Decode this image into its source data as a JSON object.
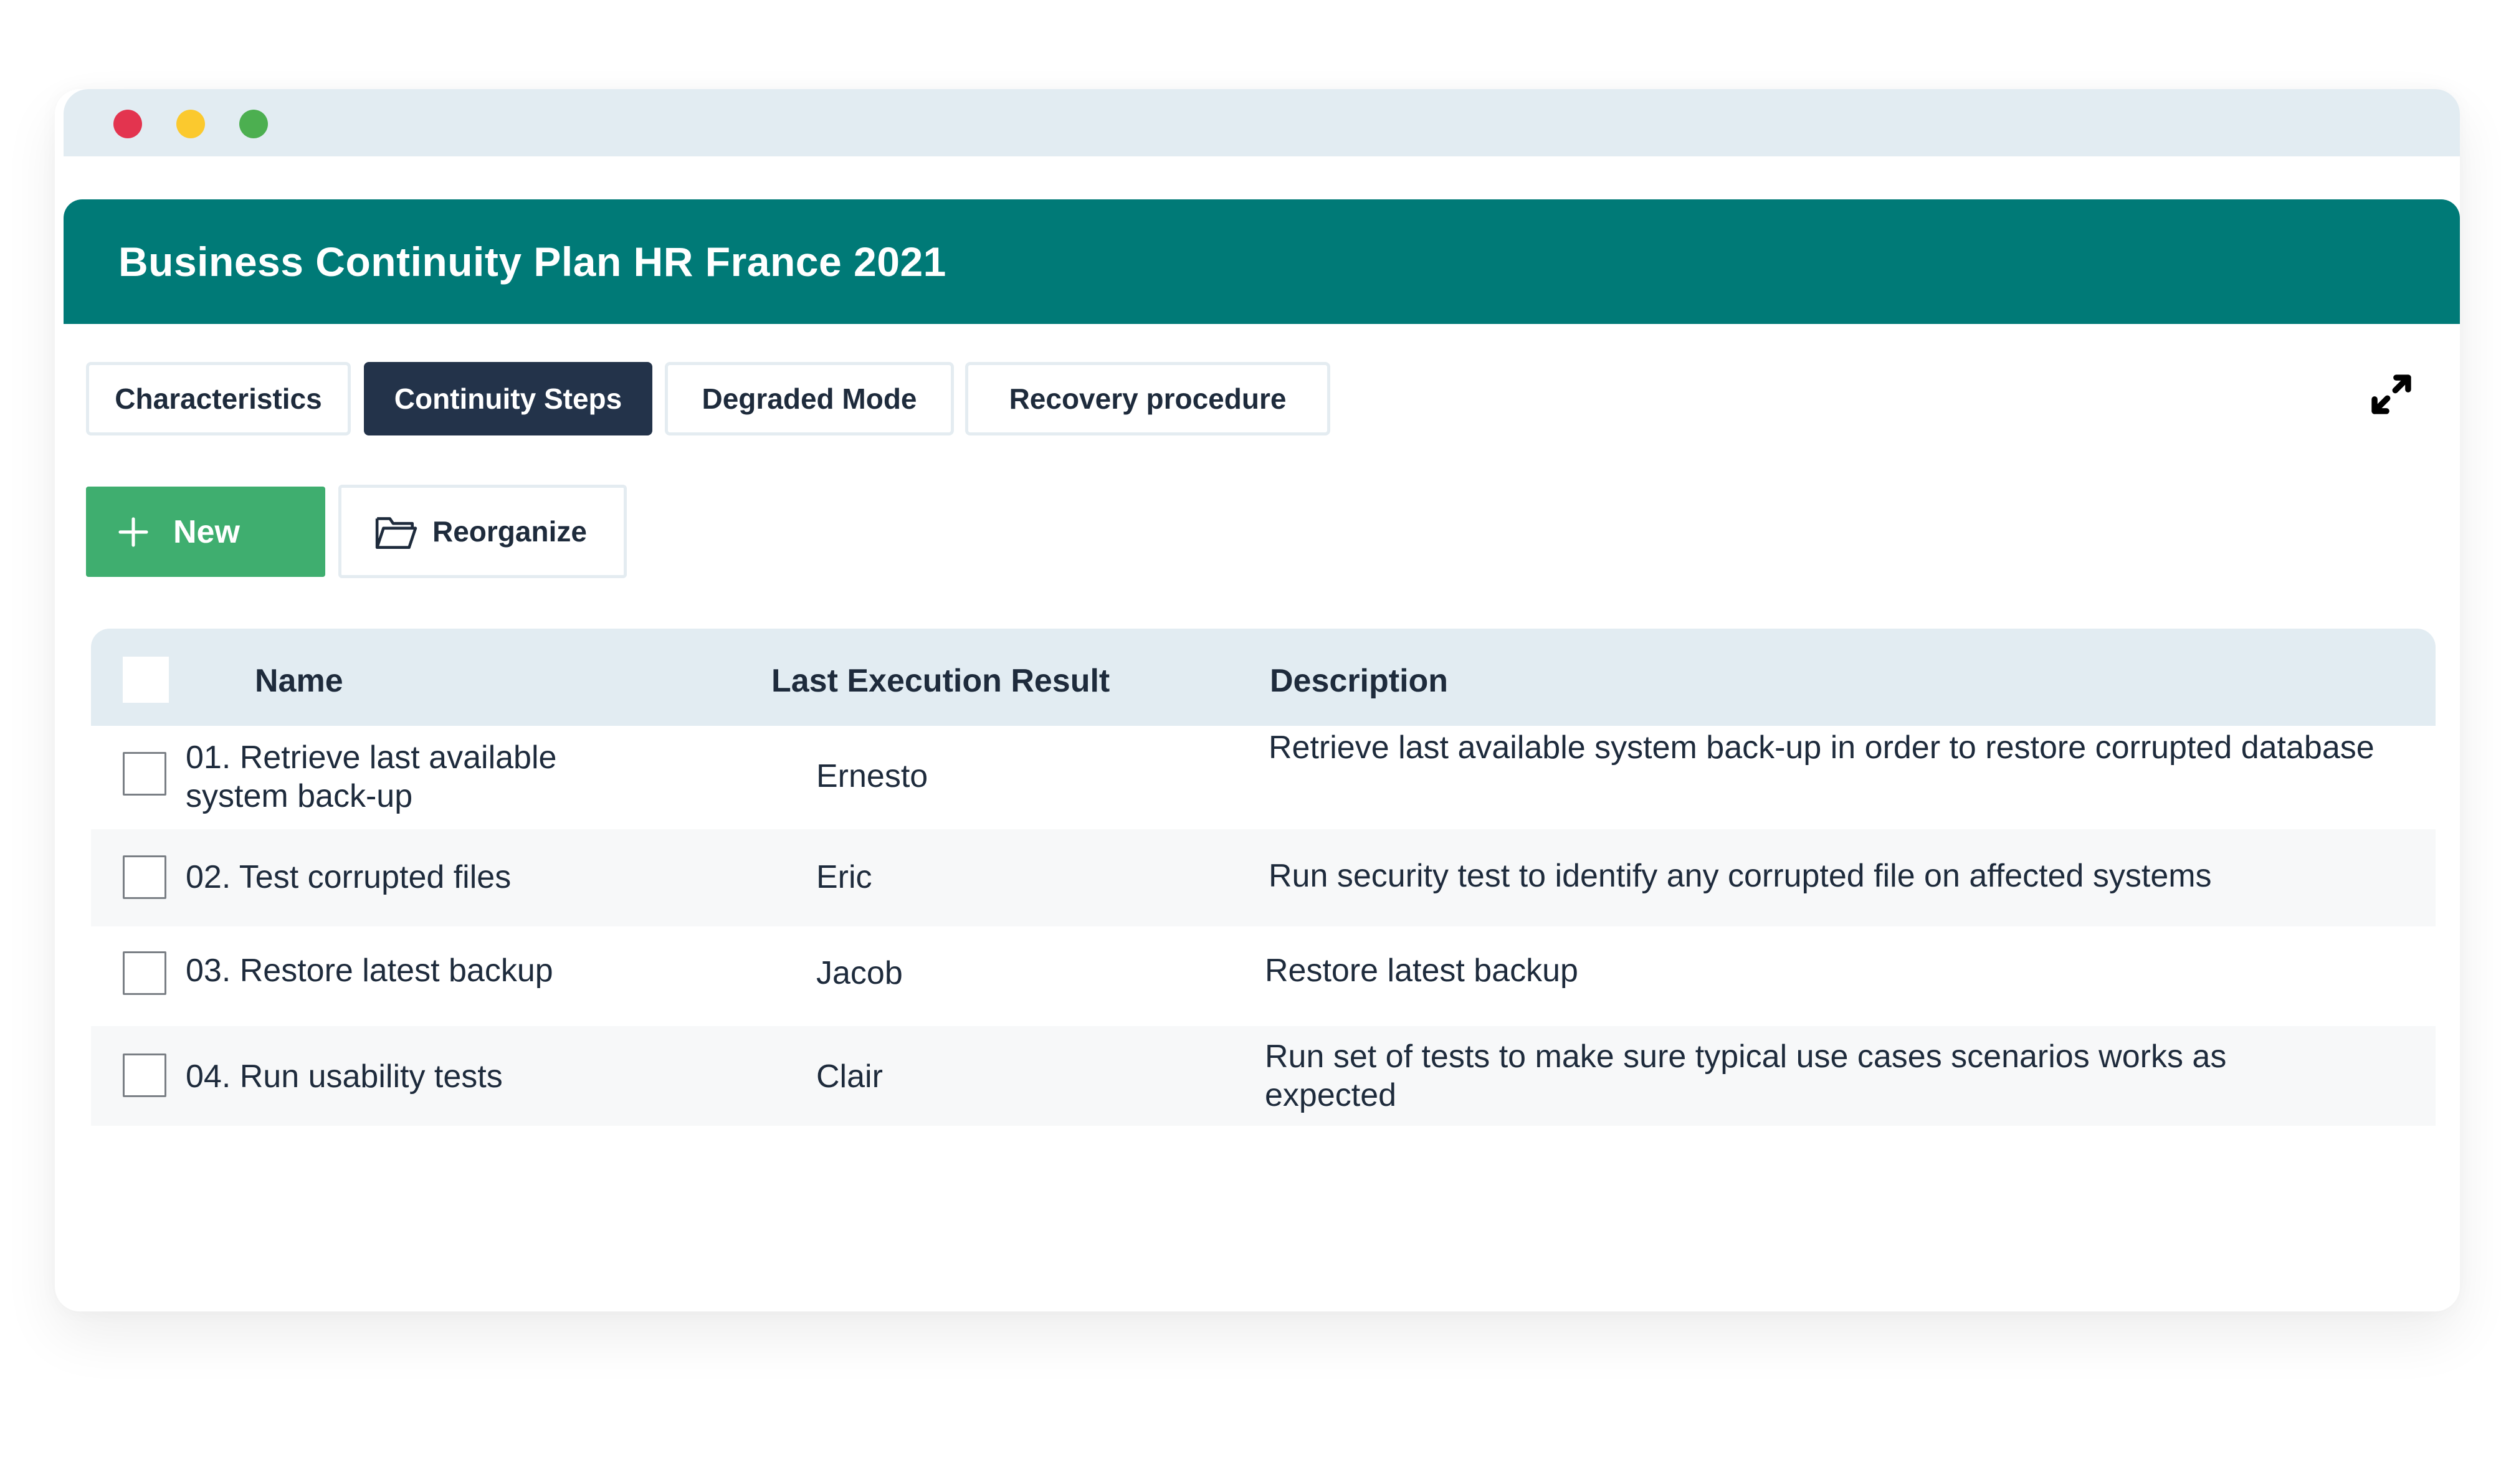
{
  "window": {
    "controls": [
      {
        "name": "close",
        "color": "#e3344f"
      },
      {
        "name": "minimize",
        "color": "#fbc92e"
      },
      {
        "name": "maximize",
        "color": "#4caf50"
      }
    ]
  },
  "header": {
    "title": "Business Continuity Plan HR France 2021",
    "color": "#007a77"
  },
  "tabs": [
    {
      "label": "Characteristics",
      "active": false
    },
    {
      "label": "Continuity Steps",
      "active": true
    },
    {
      "label": "Degraded Mode",
      "active": false
    },
    {
      "label": "Recovery procedure",
      "active": false
    }
  ],
  "toolbar": {
    "new_label": "New",
    "new_icon": "plus-icon",
    "reorganize_label": "Reorganize",
    "reorganize_icon": "folder-icon",
    "expand_icon": "expand-icon",
    "new_color": "#3fae6f"
  },
  "table": {
    "columns": [
      "Name",
      "Last Execution Result",
      "Description"
    ],
    "rows": [
      {
        "name": "01. Retrieve last available system back-up",
        "result": "Ernesto",
        "description": "Retrieve last available system back-up in order to restore corrupted database",
        "checked": false
      },
      {
        "name": "02. Test corrupted files",
        "result": "Eric",
        "description": "Run security test to identify any corrupted file on affected systems",
        "checked": false
      },
      {
        "name": "03. Restore latest backup",
        "result": "Jacob",
        "description": "Restore latest backup",
        "checked": false
      },
      {
        "name": "04. Run usability tests",
        "result": "Clair",
        "description": "Run set of tests to make sure typical use cases scenarios works as expected",
        "checked": false
      }
    ]
  }
}
